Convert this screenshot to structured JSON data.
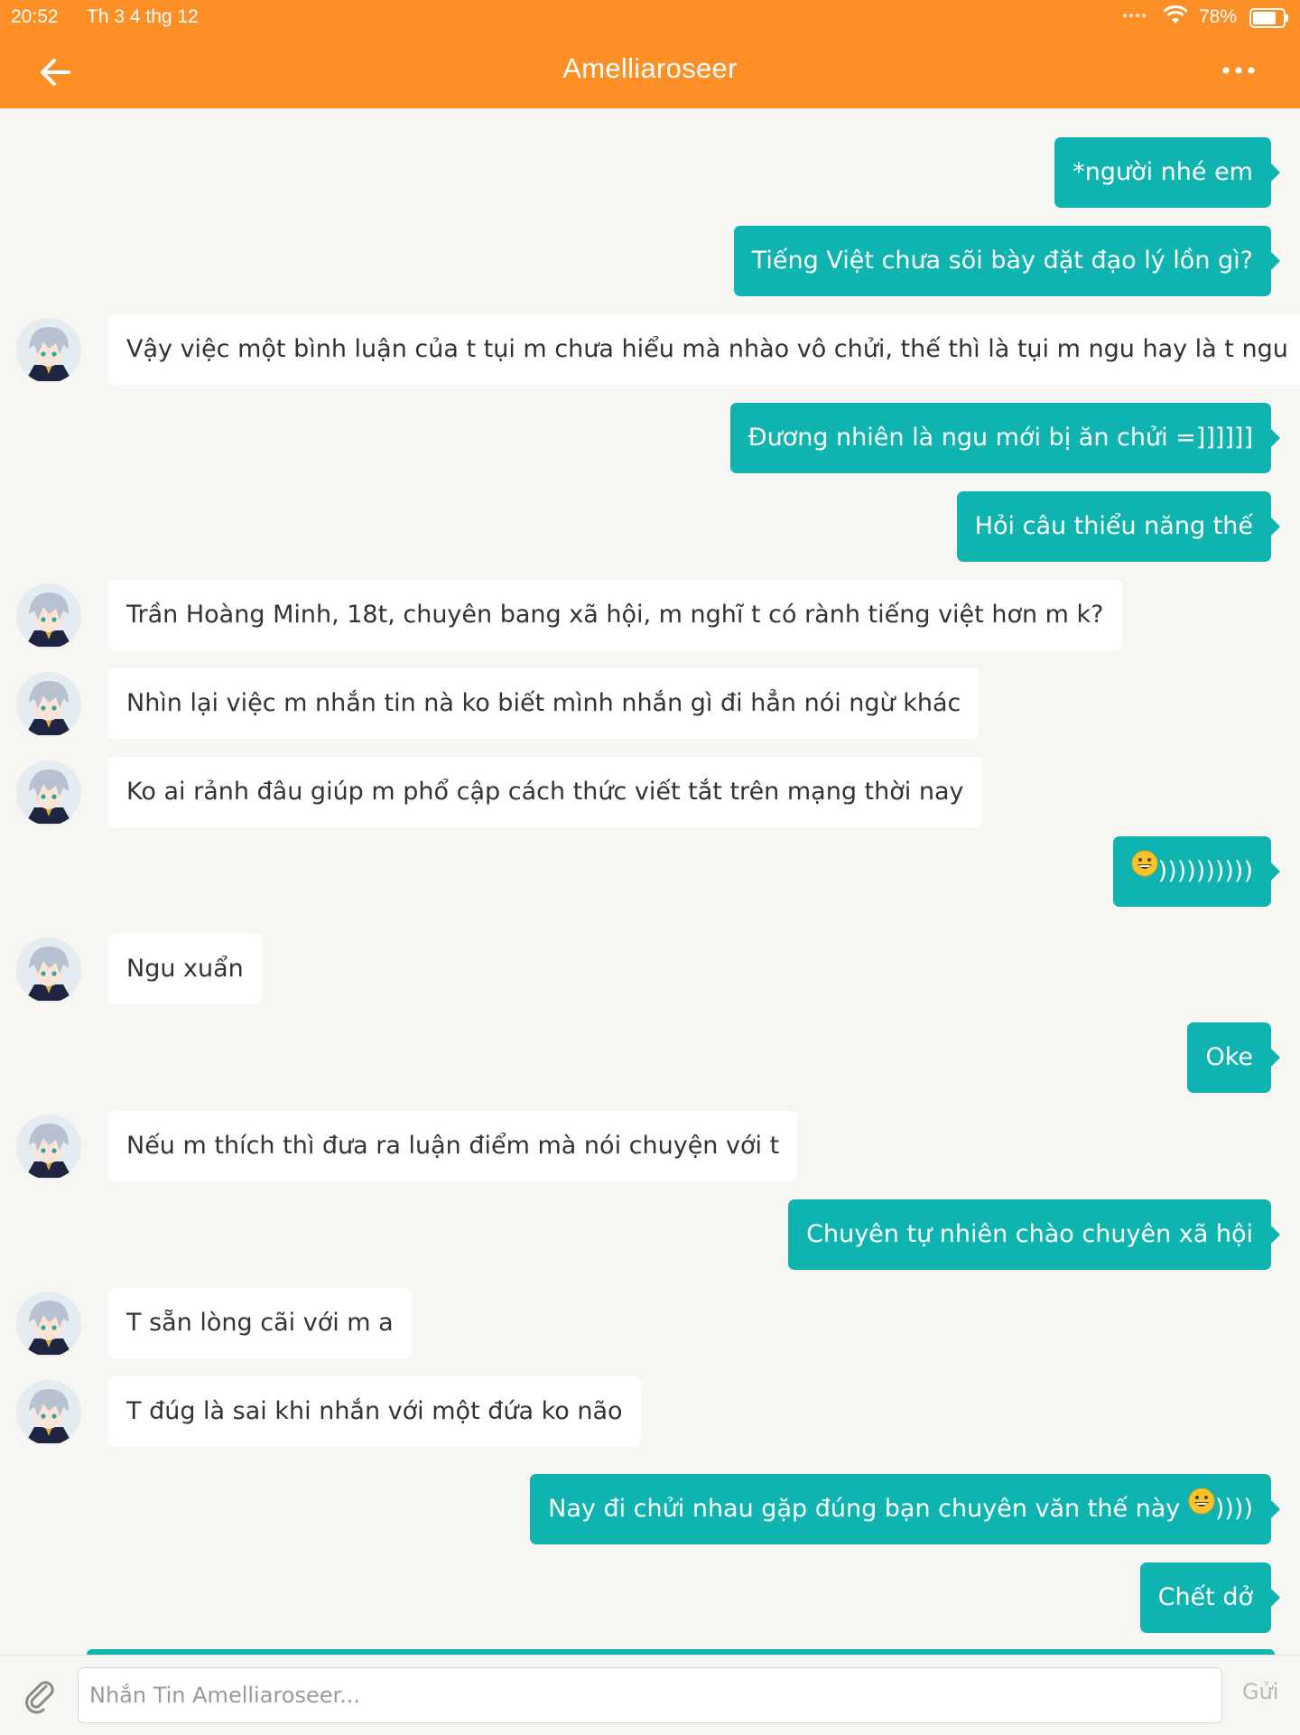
{
  "status_bar": {
    "time": "20:52",
    "date": "Th 3 4 thg 12",
    "battery": "78%",
    "battery_level": 0.78
  },
  "header": {
    "title": "Amelliaroseer",
    "back_icon": "arrow-left-icon",
    "more_icon": "more-dots-icon"
  },
  "colors": {
    "accent": "#fc9026",
    "bubble_out": "#0fb4b0",
    "bubble_in": "#ffffff",
    "background": "#f7f6f2"
  },
  "messages": [
    {
      "dir": "out",
      "text": "*người nhé em"
    },
    {
      "dir": "out",
      "text": "Tiếng Việt chưa sõi bày đặt đạo lý lồn gì?"
    },
    {
      "dir": "in",
      "text": "Vậy việc một bình luận của t tụi m chưa hiểu mà nhào vô chửi, thế thì là tụi m ngu hay là t ngu"
    },
    {
      "dir": "out",
      "text": "Đương nhiên là ngu mới bị ăn chửi =]]]]]]"
    },
    {
      "dir": "out",
      "text": "Hỏi câu thiểu năng thế"
    },
    {
      "dir": "in",
      "text": "Trần Hoàng Minh, 18t, chuyên bang xã hội, m nghĩ t có rành tiếng việt hơn m k?"
    },
    {
      "dir": "in",
      "text": "Nhìn lại việc m nhắn tin nà ko biết mình nhắn gì đi hẳn nói ngừ khác"
    },
    {
      "dir": "in",
      "text": "Ko ai rảnh đâu giúp m phổ cập cách thức viết tắt trên mạng thời nay"
    },
    {
      "dir": "out",
      "text": "))))))))))",
      "emoji": "grinning-face-icon"
    },
    {
      "dir": "in",
      "text": "Ngu xuẩn"
    },
    {
      "dir": "out",
      "text": "Oke"
    },
    {
      "dir": "in",
      "text": "Nếu m thích thì đưa ra luận điểm mà nói chuyện với t"
    },
    {
      "dir": "out",
      "text": "Chuyên tự nhiên chào chuyên xã hội"
    },
    {
      "dir": "in",
      "text": "T sẵn lòng cãi với m a"
    },
    {
      "dir": "in",
      "text": "T đúg là sai khi nhắn với một đứa ko não"
    },
    {
      "dir": "out",
      "text": "Nay đi chửi nhau gặp đúng bạn chuyên văn thế này ",
      "emoji": "grinning-face-icon",
      "suffix": "))))"
    },
    {
      "dir": "out",
      "text": "Chết dở"
    }
  ],
  "input": {
    "placeholder": "Nhắn Tin Amelliaroseer...",
    "value": "",
    "send_label": "Gửi",
    "attach_icon": "paperclip-icon"
  }
}
